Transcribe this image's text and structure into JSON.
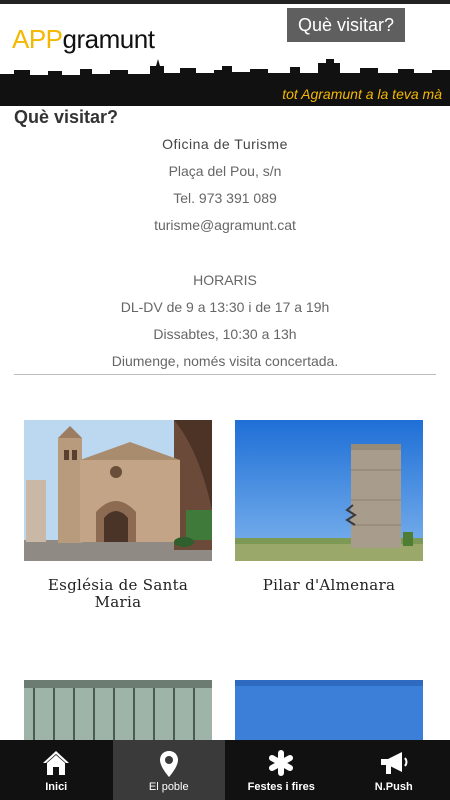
{
  "header": {
    "logo_app": "APP",
    "logo_rest": "gramunt",
    "button_label": "Què visitar?",
    "tagline": "tot Agramunt a la teva mà"
  },
  "page": {
    "title": "Què visitar?",
    "office": "Oficina de Turisme",
    "address": "Plaça del Pou, s/n",
    "phone": "Tel. 973 391 089",
    "email": "turisme@agramunt.cat",
    "hours_title": "HORARIS",
    "hours_weekday": "DL-DV de 9 a 13:30 i de 17 a 19h",
    "hours_saturday": "Dissabtes, 10:30 a 13h",
    "hours_sunday": "Diumenge, només visita concertada."
  },
  "places": [
    {
      "name": "Església de Santa Maria"
    },
    {
      "name": "Pilar d'Almenara"
    },
    {
      "name": ""
    },
    {
      "name": ""
    }
  ],
  "nav": {
    "items": [
      {
        "label": "Inici",
        "icon": "home-icon"
      },
      {
        "label": "El poble",
        "icon": "map-pin-icon"
      },
      {
        "label": "Festes i fires",
        "icon": "asterisk-icon"
      },
      {
        "label": "N.Push",
        "icon": "megaphone-icon"
      }
    ],
    "active_index": 1
  },
  "colors": {
    "brand_yellow": "#f5b800",
    "nav_bg": "#111111",
    "nav_active": "#3a3a3a"
  }
}
